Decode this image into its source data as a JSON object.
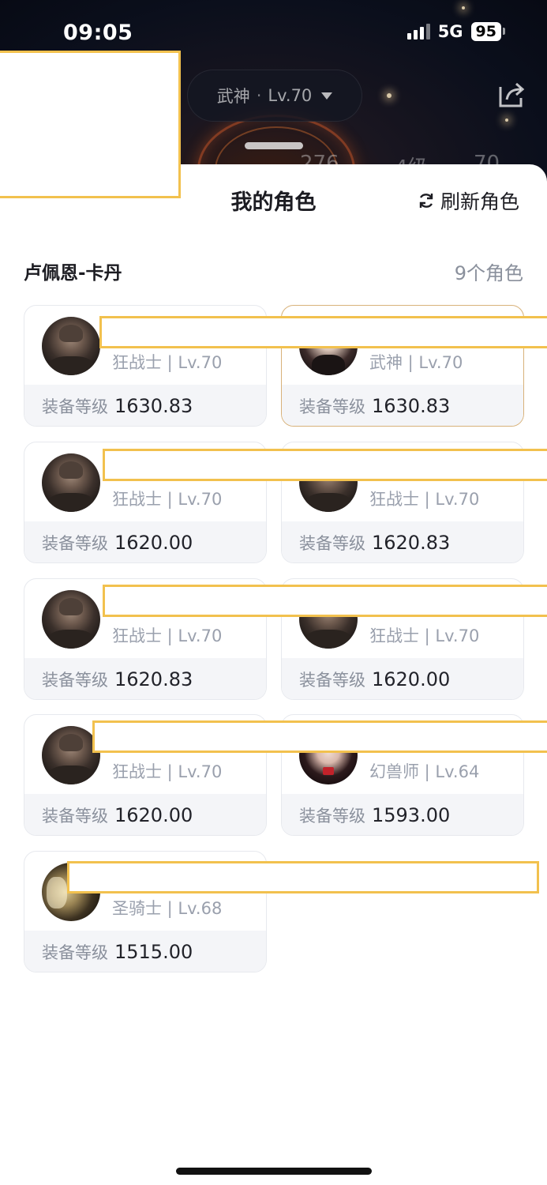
{
  "status_bar": {
    "time": "09:05",
    "network": "5G",
    "battery": "95"
  },
  "header": {
    "role_selector_label": "武神",
    "role_selector_separator": "·",
    "role_selector_level": "Lv.70"
  },
  "sheet": {
    "title": "我的角色",
    "refresh_label": "刷新角色",
    "server_name": "卢佩恩-卡丹",
    "role_count": "9个角色"
  },
  "characters": [
    {
      "class_level": "狂战士 | Lv.70",
      "gear_label": "装备等级",
      "gear_value": "1630.83",
      "avatar": "berserker",
      "selected": false
    },
    {
      "class_level": "武神 | Lv.70",
      "gear_label": "装备等级",
      "gear_value": "1630.83",
      "avatar": "wushen",
      "selected": true
    },
    {
      "class_level": "狂战士 | Lv.70",
      "gear_label": "装备等级",
      "gear_value": "1620.00",
      "avatar": "berserker",
      "selected": false
    },
    {
      "class_level": "狂战士 | Lv.70",
      "gear_label": "装备等级",
      "gear_value": "1620.83",
      "avatar": "berserker",
      "selected": false
    },
    {
      "class_level": "狂战士 | Lv.70",
      "gear_label": "装备等级",
      "gear_value": "1620.83",
      "avatar": "berserker",
      "selected": false
    },
    {
      "class_level": "狂战士 | Lv.70",
      "gear_label": "装备等级",
      "gear_value": "1620.00",
      "avatar": "berserker",
      "selected": false
    },
    {
      "class_level": "狂战士 | Lv.70",
      "gear_label": "装备等级",
      "gear_value": "1620.00",
      "avatar": "berserker",
      "selected": false
    },
    {
      "class_level": "幻兽师 | Lv.64",
      "gear_label": "装备等级",
      "gear_value": "1593.00",
      "avatar": "summoner",
      "selected": false
    },
    {
      "class_level": "圣骑士 | Lv.68",
      "gear_label": "装备等级",
      "gear_value": "1515.00",
      "avatar": "paladin",
      "selected": false
    }
  ],
  "colors": {
    "redaction_border": "#f2c14e",
    "selected_border": "#d8b27a",
    "muted_text": "#8a909c"
  }
}
